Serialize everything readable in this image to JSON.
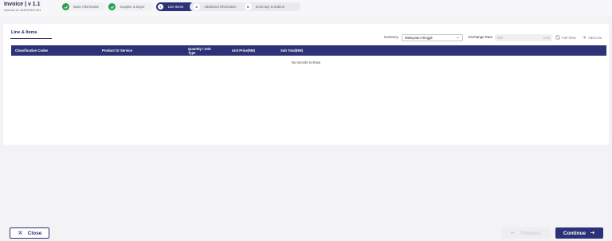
{
  "header": {
    "title": "Invoice | v 1.1",
    "internal_id": "Internal ID 244497007441"
  },
  "steps": [
    {
      "label": "Basic Information",
      "state": "done",
      "icon": "check-icon"
    },
    {
      "label": "Supplier & Buyer",
      "state": "done",
      "icon": "check-icon"
    },
    {
      "label": "Line Items",
      "state": "active",
      "number": "3"
    },
    {
      "label": "Additional Information",
      "state": "todo",
      "number": "4"
    },
    {
      "label": "Summary & Submit",
      "state": "todo",
      "number": "5"
    }
  ],
  "card": {
    "tab_label": "Line & Items",
    "currency_label": "Currency",
    "currency_value": "Malaysian Ringgit",
    "exchange_rate_label": "Exchange Rate",
    "exchange_rate_prefix": "RM",
    "exchange_rate_value": "0.00",
    "full_view_label": "Full View",
    "add_line_label": "Add Line"
  },
  "table": {
    "columns": [
      "Classification Codes",
      "Product Or Service",
      "Quantity / Unit Type",
      "Unit Price(RM)",
      "Sub Total(RM)"
    ],
    "empty_text": "No records to show"
  },
  "footer": {
    "close_label": "Close",
    "previous_label": "Previous",
    "continue_label": "Continue"
  },
  "colors": {
    "primary": "#2b3277",
    "success": "#2e9e50"
  }
}
